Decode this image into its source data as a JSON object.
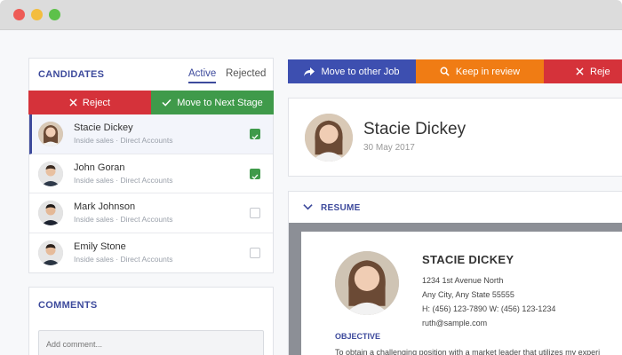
{
  "candidates_panel": {
    "title": "CANDIDATES",
    "tabs": [
      {
        "label": "Active",
        "active": true
      },
      {
        "label": "Rejected",
        "active": false
      }
    ],
    "reject_label": "Reject",
    "next_stage_label": "Move to Next Stage",
    "items": [
      {
        "name": "Stacie Dickey",
        "subtitle": "Inside sales · Direct Accounts",
        "checked": true,
        "selected": true
      },
      {
        "name": "John Goran",
        "subtitle": "Inside sales · Direct Accounts",
        "checked": true,
        "selected": false
      },
      {
        "name": "Mark Johnson",
        "subtitle": "Inside sales · Direct Accounts",
        "checked": false,
        "selected": false
      },
      {
        "name": "Emily Stone",
        "subtitle": "Inside sales · Direct Accounts",
        "checked": false,
        "selected": false
      }
    ]
  },
  "comments": {
    "title": "COMMENTS",
    "placeholder": "Add comment..."
  },
  "actions": {
    "move_label": "Move to other Job",
    "keep_label": "Keep in review",
    "reject_label": "Reje"
  },
  "profile": {
    "name": "Stacie Dickey",
    "date": "30 May 2017"
  },
  "resume": {
    "title": "RESUME",
    "name": "STACIE DICKEY",
    "address1": "1234 1st Avenue North",
    "address2": "Any City, Any State 55555",
    "phone": "H: (456) 123-7890 W: (456) 123-1234",
    "email": "ruth@sample.com",
    "objective_title": "OBJECTIVE",
    "objective_text": "To obtain a challenging position with a market leader that utilizes my experi"
  },
  "colors": {
    "accent": "#3d4a9c",
    "reject": "#d5323a",
    "success": "#3f9a4a",
    "move": "#3d4fb0",
    "keep": "#f07c14"
  }
}
